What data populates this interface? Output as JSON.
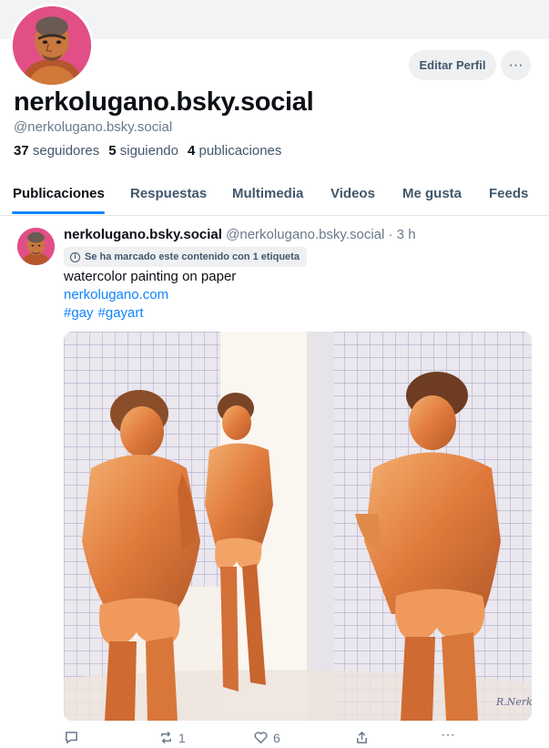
{
  "profile": {
    "display_name": "nerkolugano.bsky.social",
    "handle": "@nerkolugano.bsky.social",
    "edit_button": "Editar Perfil",
    "more_button": "···",
    "stats": {
      "followers_count": "37",
      "followers_label": "seguidores",
      "following_count": "5",
      "following_label": "siguiendo",
      "posts_count": "4",
      "posts_label": "publicaciones"
    }
  },
  "tabs": [
    {
      "label": "Publicaciones",
      "active": true
    },
    {
      "label": "Respuestas",
      "active": false
    },
    {
      "label": "Multimedia",
      "active": false
    },
    {
      "label": "Videos",
      "active": false
    },
    {
      "label": "Me gusta",
      "active": false
    },
    {
      "label": "Feeds",
      "active": false
    }
  ],
  "post": {
    "author": "nerkolugano.bsky.social",
    "handle": "@nerkolugano.bsky.social",
    "time": "· 3 h",
    "label_notice": "Se ha marcado este contenido con 1 etiqueta",
    "text": "watercolor painting on paper",
    "link": "nerkolugano.com",
    "tags": [
      "#gay",
      "#gayart"
    ],
    "image_signature": "R.Nerko",
    "actions": {
      "reply_icon": "comment-icon",
      "reply_count": "",
      "repost_icon": "repost-icon",
      "repost_count": "1",
      "like_icon": "heart-icon",
      "like_count": "6",
      "share_icon": "share-icon",
      "more_icon": "more-icon",
      "more_label": "···"
    }
  },
  "colors": {
    "accent": "#1083fe",
    "text_primary": "#0b0f14",
    "text_secondary": "#6a7a8c",
    "chip_bg": "#eef0f2",
    "avatar_bg": "#e14f86"
  }
}
